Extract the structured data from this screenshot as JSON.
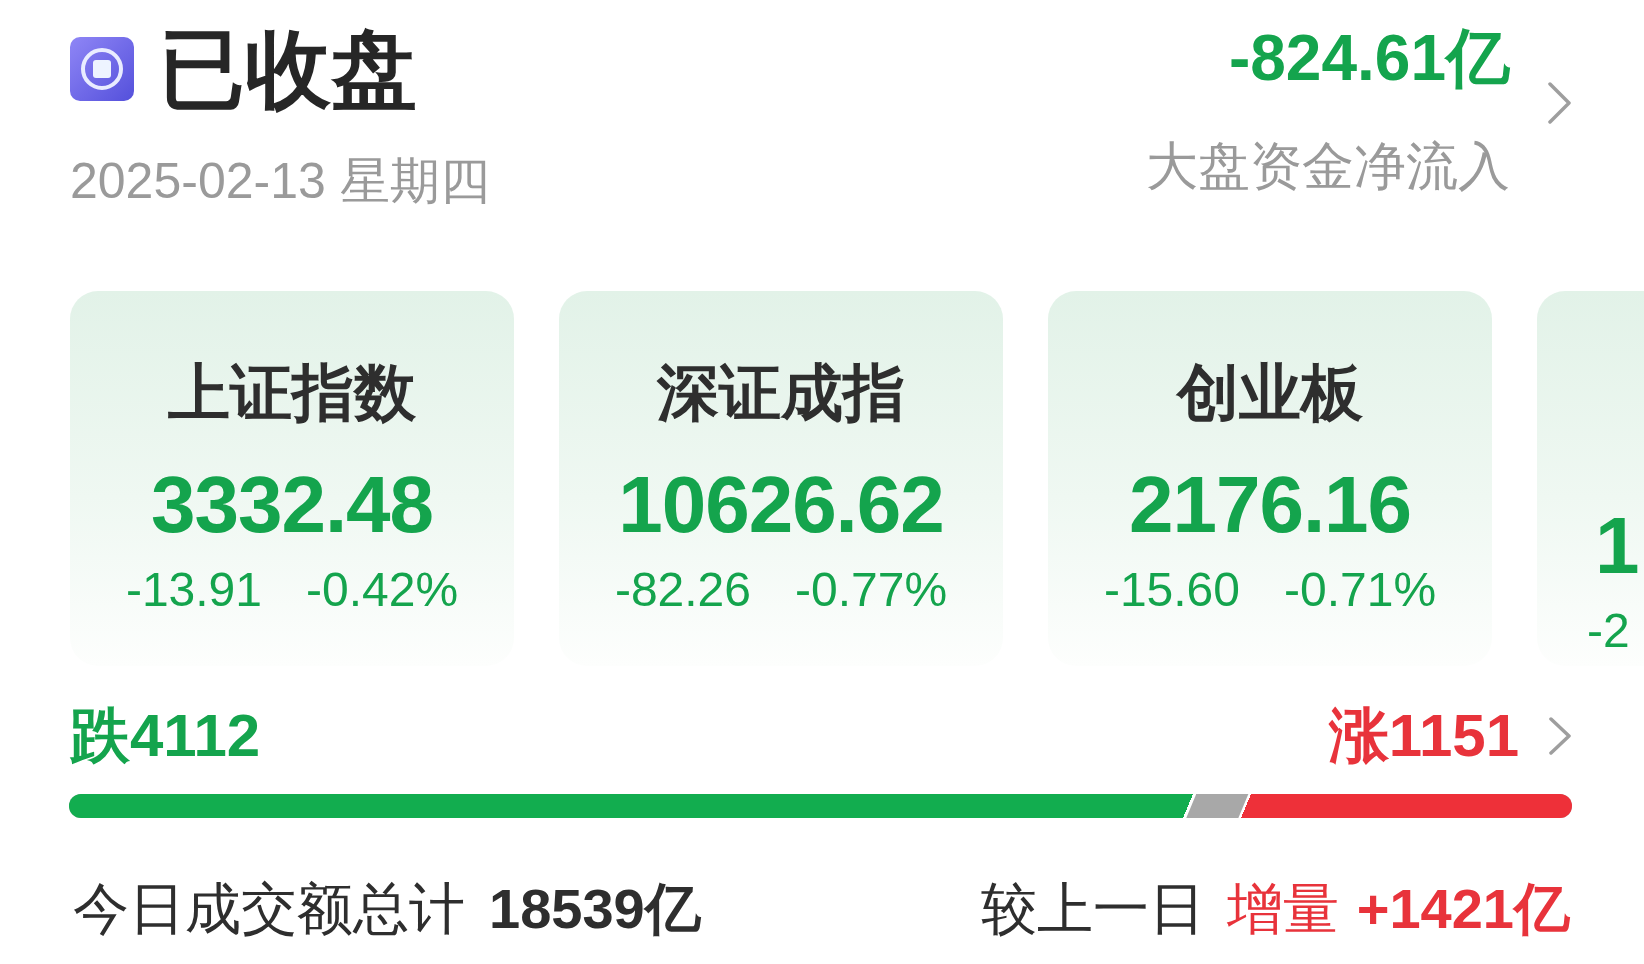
{
  "header": {
    "status": {
      "title": "已收盘",
      "date": "2025-02-13 星期四"
    },
    "net_flow": {
      "value": "-824.61亿",
      "label": "大盘资金净流入",
      "rising": false
    }
  },
  "cards": [
    {
      "kind": "full",
      "title": "上证指数",
      "value": "3332.48",
      "change": "-13.91",
      "percent": "-0.42%",
      "rising": false
    },
    {
      "kind": "full",
      "title": "深证成指",
      "value": "10626.62",
      "change": "-82.26",
      "percent": "-0.77%",
      "rising": false
    },
    {
      "kind": "full",
      "title": "创业板",
      "value": "2176.16",
      "change": "-15.60",
      "percent": "-0.71%",
      "rising": false
    },
    {
      "kind": "clipped",
      "value": "1",
      "change": "-2",
      "rising": false
    }
  ],
  "breadth": {
    "falling": "跌4112",
    "rising": "涨1151",
    "bar": {
      "falling": {
        "level": 0.75
      },
      "rising": {
        "level": 0.222
      }
    }
  },
  "turnover": {
    "label": "今日成交额总计",
    "value": "18539亿",
    "compare_label": "较上一日",
    "change_label": "增量",
    "change_value": "+1421亿",
    "rising": true
  }
}
